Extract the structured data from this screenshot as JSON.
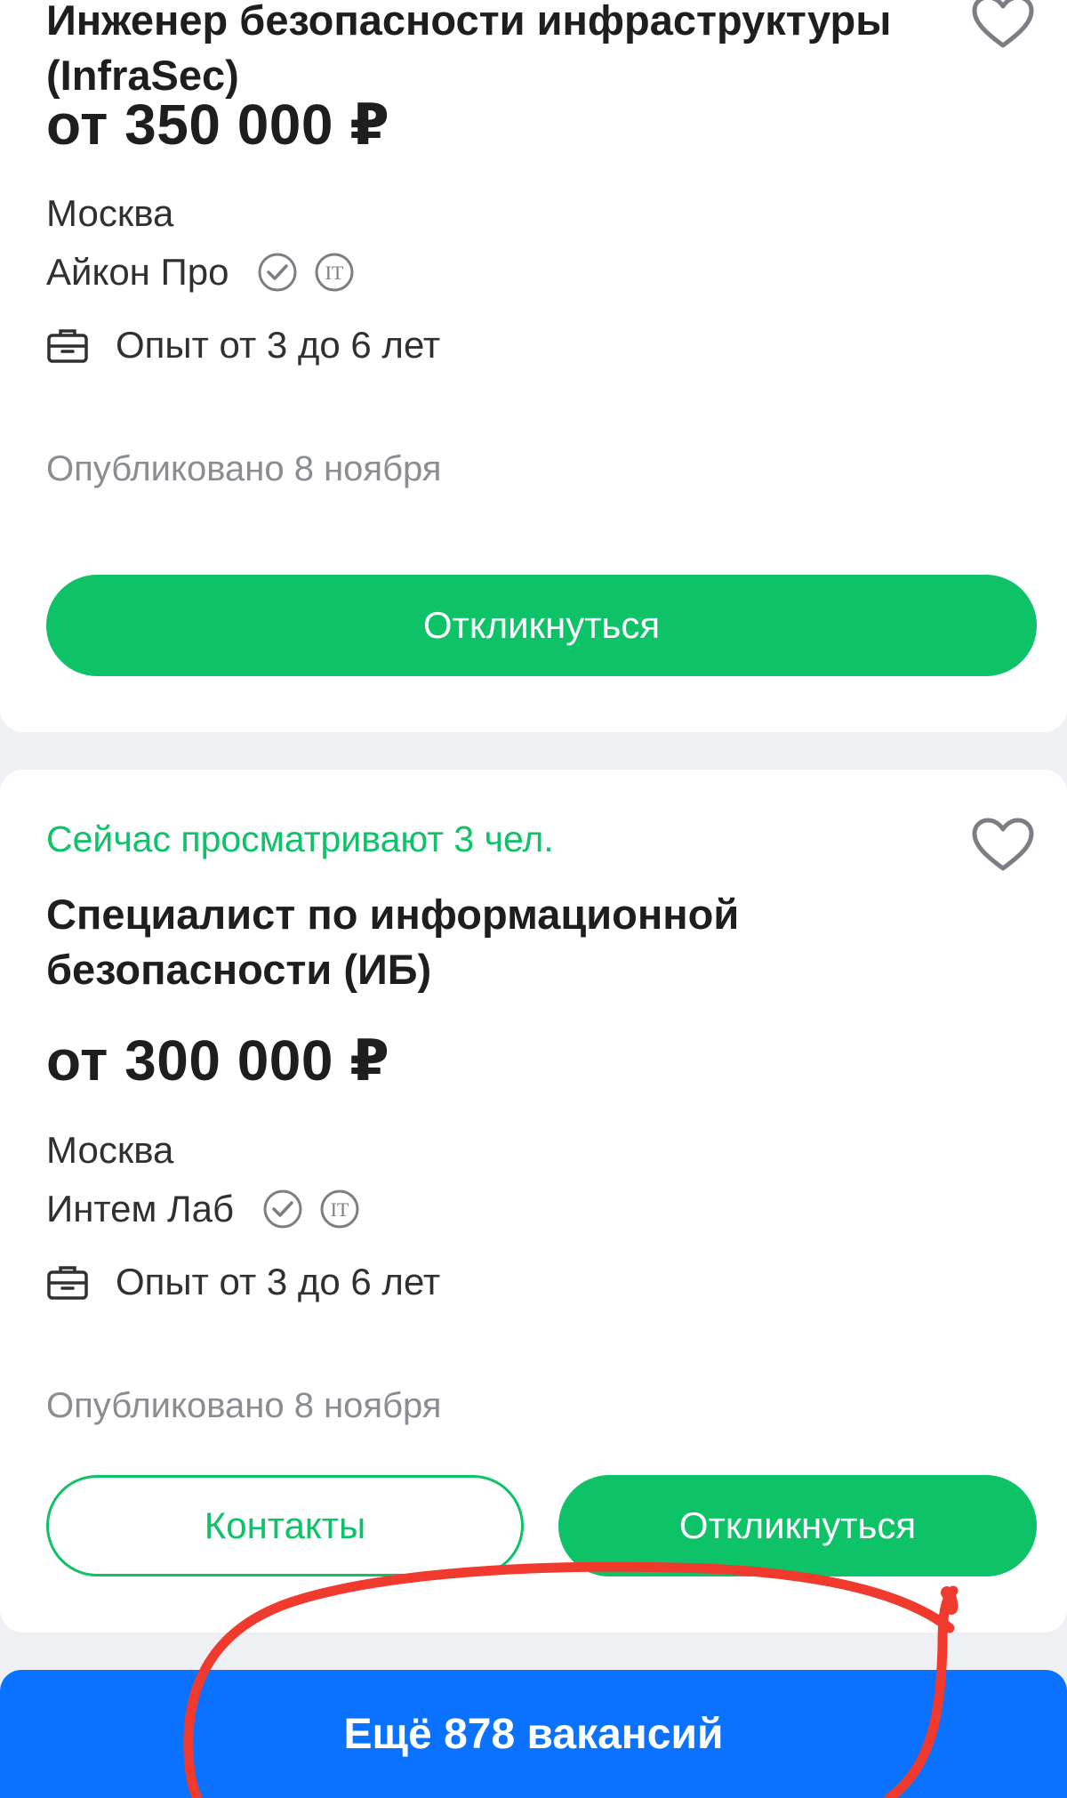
{
  "vacancies": [
    {
      "title": "Инженер безопасности инфраструктуры (InfraSec)",
      "salary": "от 350 000 ₽",
      "city": "Москва",
      "company": "Айкон Про",
      "experience": "Опыт от 3 до 6 лет",
      "published": "Опубликовано 8 ноября",
      "apply_label": "Откликнуться"
    },
    {
      "viewers": "Сейчас просматривают 3 чел.",
      "title": "Специалист по информационной безопасности (ИБ)",
      "salary": "от 300 000 ₽",
      "city": "Москва",
      "company": "Интем Лаб",
      "experience": "Опыт от 3 до 6 лет",
      "published": "Опубликовано 8 ноября",
      "contacts_label": "Контакты",
      "apply_label": "Откликнуться"
    }
  ],
  "badges": {
    "it_label": "IT"
  },
  "more_button": {
    "label": "Ещё 878 вакансий"
  },
  "colors": {
    "accent_green": "#0dc267",
    "accent_blue": "#0a72ff",
    "annotation_red": "#f03a2e"
  },
  "icons": [
    "heart-icon",
    "verified-check-icon",
    "it-badge-icon",
    "briefcase-icon"
  ]
}
